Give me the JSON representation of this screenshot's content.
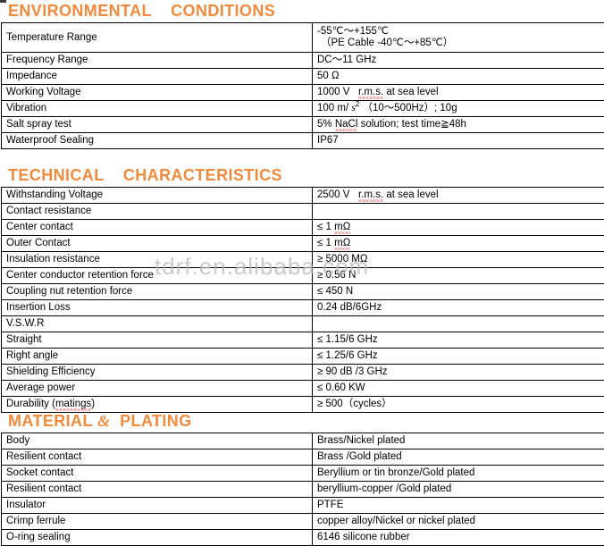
{
  "document": {
    "watermark": "tdrf.en.alibaba.com",
    "accent_color": "#F08A3C",
    "text_color": "#000000",
    "border_color": "#000000"
  },
  "sections": [
    {
      "id": "environmental",
      "heading": "ENVIRONMENTAL    CONDITIONS",
      "rows": [
        {
          "parameter": "Temperature Range",
          "value_line1": "-55℃～+155℃",
          "value_line2": "（PE Cable -40℃～+85℃）"
        },
        {
          "parameter": "Frequency Range",
          "value": "DC～11 GHz"
        },
        {
          "parameter": "Impedance",
          "value": "50 Ω"
        },
        {
          "parameter": "Working Voltage",
          "value_prefix": "1000 V",
          "value_misspelled": "r.m.s.",
          "value_suffix": " at sea level"
        },
        {
          "parameter": "Vibration",
          "value_prefix": "100 m/ ",
          "value_italic": "s",
          "value_sup": "2",
          "value_suffix": "  （10～500Hz）;    10g"
        },
        {
          "parameter": "Salt spray test",
          "value_prefix": "5% ",
          "value_misspelled": "NaCl",
          "value_suffix": " solution; test time≧48h"
        },
        {
          "parameter": "Waterproof Sealing",
          "value": "IP67"
        }
      ]
    },
    {
      "id": "technical",
      "heading": "TECHNICAL    CHARACTERISTICS",
      "rows": [
        {
          "parameter": "Withstanding Voltage",
          "value_prefix": "2500 V",
          "value_misspelled": "r.m.s.",
          "value_suffix": " at sea level"
        },
        {
          "parameter": "Contact resistance",
          "value": ""
        },
        {
          "parameter": "Center contact",
          "value_prefix": "≤ 1 ",
          "value_misspelled": "mΩ",
          "value_suffix": ""
        },
        {
          "parameter": "Outer Contact",
          "value_prefix": "≤ 1 ",
          "value_misspelled": "mΩ",
          "value_suffix": ""
        },
        {
          "parameter": "Insulation resistance",
          "value": "≥ 5000 MΩ"
        },
        {
          "parameter": "Center conductor retention force",
          "value": "≥ 0.56 N"
        },
        {
          "parameter": "Coupling nut retention force",
          "value": "≤ 450 N"
        },
        {
          "parameter": "Insertion Loss",
          "value": "0.24 dB/6GHz"
        },
        {
          "parameter": "V.S.W.R",
          "value": ""
        },
        {
          "parameter": "Straight",
          "value": "≤ 1.15/6 GHz"
        },
        {
          "parameter": "Right angle",
          "value": "≤ 1.25/6 GHz"
        },
        {
          "parameter": "Shielding Efficiency",
          "value": "≥ 90 dB /3 GHz"
        },
        {
          "parameter": "Average power",
          "value": "≤ 0.60 KW"
        },
        {
          "parameter": "Durability (matings)",
          "parameter_misspelled": "matings",
          "value": "≥ 500（cycles）"
        }
      ]
    },
    {
      "id": "material",
      "heading": "MATERIAL & PLATING",
      "heading_part1": "MATERIAL ",
      "heading_amp": "&",
      "heading_part2": "  PLATING",
      "rows": [
        {
          "parameter": "Body",
          "value": "Brass/Nickel plated"
        },
        {
          "parameter": "Resilient contact",
          "value": "Brass /Gold plated"
        },
        {
          "parameter": "Socket contact",
          "value": "Beryllium or tin bronze/Gold plated"
        },
        {
          "parameter": "Resilient contact",
          "value": "beryllium-copper /Gold plated"
        },
        {
          "parameter": "Insulator",
          "value": "PTFE"
        },
        {
          "parameter": "Crimp ferrule",
          "value": "copper alloy/Nickel or nickel plated"
        },
        {
          "parameter": "O-ring sealing",
          "value": "6146 silicone rubber"
        }
      ]
    }
  ]
}
